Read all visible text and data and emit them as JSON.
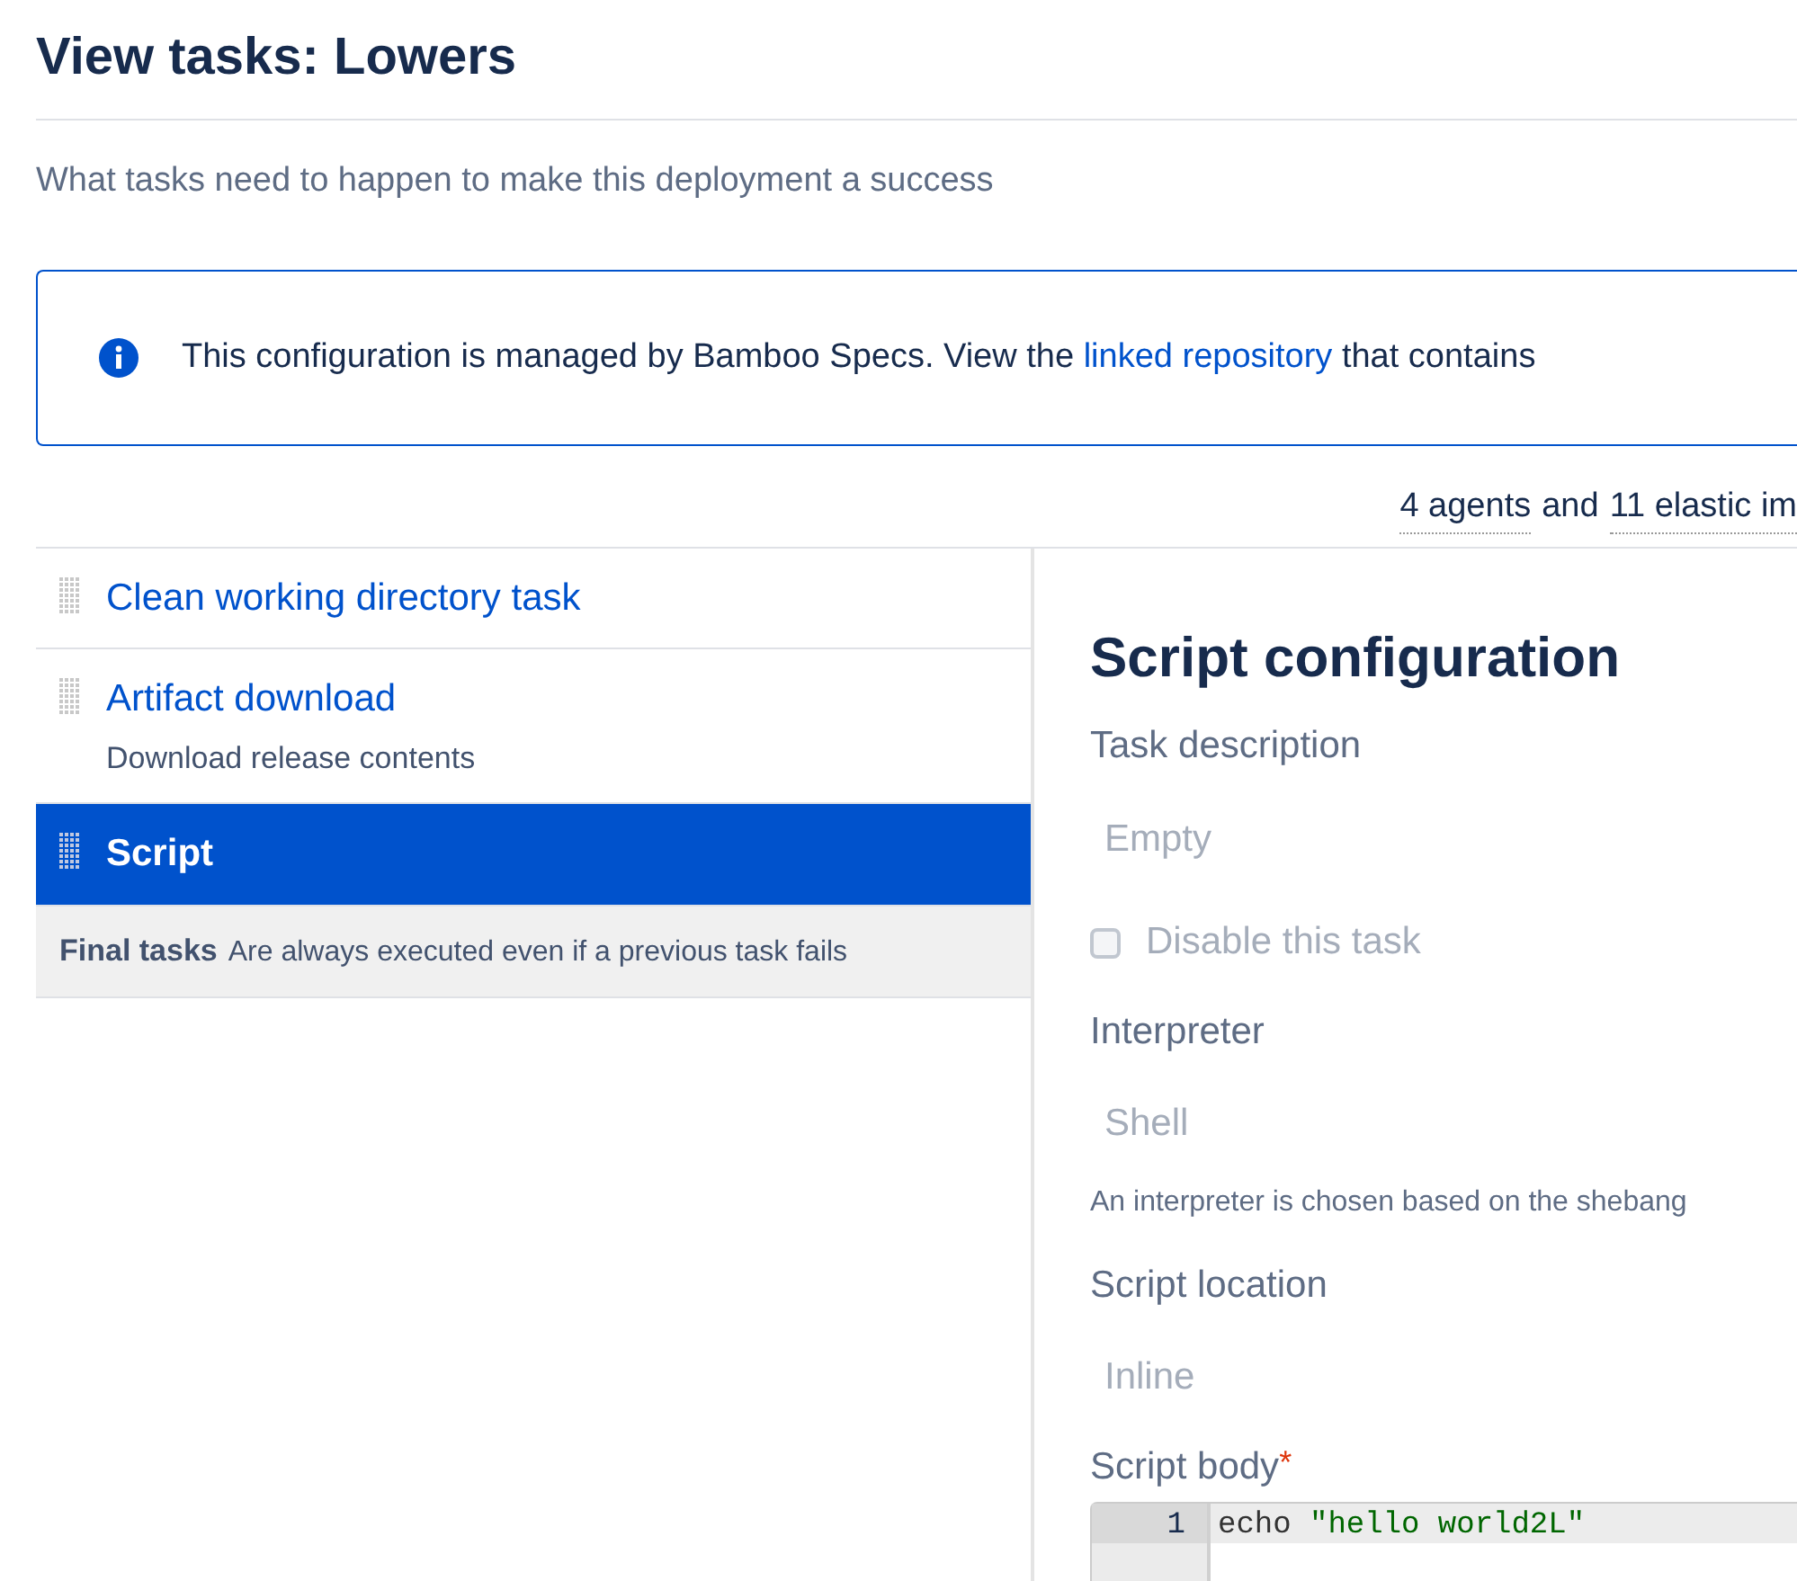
{
  "page_title": "View tasks: Lowers",
  "description": "What tasks need to happen to make this deployment a success",
  "info_message": {
    "before": "This configuration is managed by Bamboo Specs. View the",
    "link": "linked repository",
    "after": "that contains"
  },
  "agents_summary": {
    "agents": "4 agents",
    "middle": "and",
    "elastic": "11 elastic im"
  },
  "tasks": [
    {
      "name": "Clean working directory task",
      "selected": false
    },
    {
      "name": "Artifact download",
      "description": "Download release contents",
      "selected": false
    },
    {
      "name": "Script",
      "selected": true
    }
  ],
  "final_tasks": {
    "label": "Final tasks",
    "text": "Are always executed even if a previous task fails"
  },
  "config": {
    "title": "Script configuration",
    "task_description": {
      "label": "Task description",
      "value": "Empty"
    },
    "disable_task": {
      "label": "Disable this task",
      "checked": false
    },
    "interpreter": {
      "label": "Interpreter",
      "value": "Shell",
      "help": "An interpreter is chosen based on the shebang"
    },
    "script_location": {
      "label": "Script location",
      "value": "Inline"
    },
    "script_body": {
      "label": "Script body",
      "required_mark": "*",
      "lines": [
        {
          "number": "1",
          "tokens": [
            {
              "kind": "command",
              "text": "echo"
            },
            {
              "kind": "string",
              "text": "\"hello world2L\""
            }
          ]
        }
      ]
    }
  }
}
